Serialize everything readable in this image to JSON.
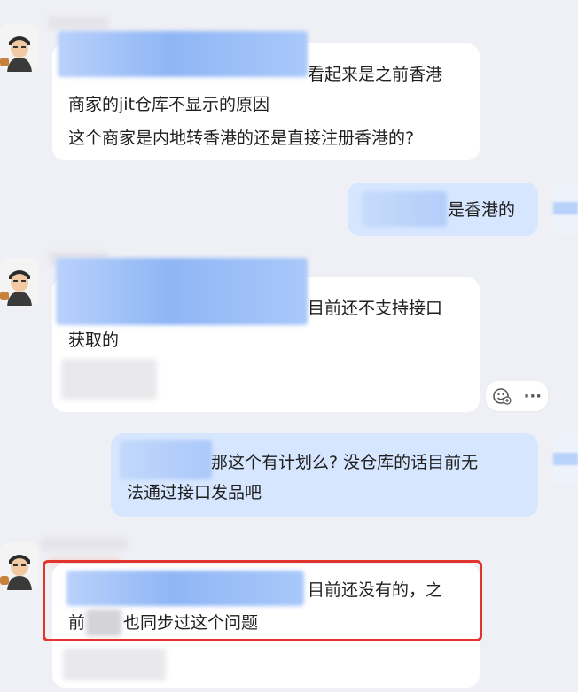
{
  "messages": [
    {
      "id": 1,
      "side": "left",
      "lines": [
        "看起来是之前香港",
        "商家的jit仓库不显示的原因",
        "这个商家是内地转香港的还是直接注册香港的?"
      ]
    },
    {
      "id": 2,
      "side": "right",
      "lines": [
        "是香港的"
      ]
    },
    {
      "id": 3,
      "side": "left",
      "lines": [
        "目前还不支持接口",
        "获取的"
      ]
    },
    {
      "id": 4,
      "side": "right",
      "lines": [
        "那这个有计划么? 没仓库的话目前无",
        "法通过接口发品吧"
      ]
    },
    {
      "id": 5,
      "side": "left",
      "lines": [
        "目前还没有的，之",
        "前",
        "也同步过这个问题"
      ]
    }
  ],
  "actions": {
    "reaction_icon": "emoji-reaction-icon",
    "more_icon": "more-dots-icon",
    "more_glyph": "···"
  },
  "colors": {
    "highlight": "#e0342d",
    "my_bubble": "#d6e6ff",
    "other_bubble": "#ffffff",
    "background": "#eff0f5"
  }
}
